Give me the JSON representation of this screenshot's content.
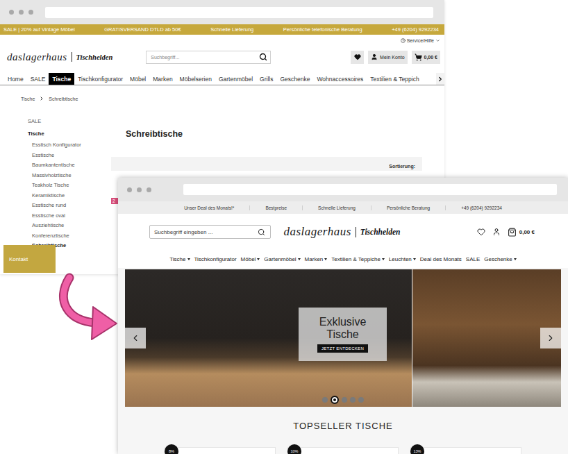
{
  "back_window": {
    "promo_bar": [
      "SALE | 20% auf Vintage Möbel",
      "GRATISVERSAND DTLD ab 50€",
      "Schnelle Lieferung",
      "Persönliche telefonische Beratung",
      "+49 (6204) 9292234"
    ],
    "service_link": "Service/Hilfe",
    "logo": {
      "name": "daslagerhaus",
      "brand": "Tischhelden"
    },
    "search": {
      "placeholder": "Suchbegriff..."
    },
    "account": "Mein Konto",
    "cart_total": "0,00 €",
    "nav": [
      {
        "label": "Home",
        "selected": false
      },
      {
        "label": "SALE",
        "selected": false
      },
      {
        "label": "Tische",
        "selected": true
      },
      {
        "label": "Tischkonfigurator",
        "selected": false
      },
      {
        "label": "Möbel",
        "selected": false
      },
      {
        "label": "Marken",
        "selected": false
      },
      {
        "label": "Möbelserien",
        "selected": false
      },
      {
        "label": "Gartenmöbel",
        "selected": false
      },
      {
        "label": "Grills",
        "selected": false
      },
      {
        "label": "Geschenke",
        "selected": false
      },
      {
        "label": "Wohnaccessoires",
        "selected": false
      },
      {
        "label": "Textilien & Teppich",
        "selected": false
      }
    ],
    "breadcrumb": [
      "Tische",
      "Schreibtische"
    ],
    "sidebar": [
      {
        "label": "SALE",
        "kind": "top",
        "selected": false
      },
      {
        "label": "Tische",
        "kind": "category",
        "selected": false
      },
      {
        "label": "Esstisch Konfigurator",
        "kind": "child",
        "selected": false
      },
      {
        "label": "Esstische",
        "kind": "child",
        "selected": false
      },
      {
        "label": "Baumkantentische",
        "kind": "child",
        "selected": false
      },
      {
        "label": "Massivholztische",
        "kind": "child",
        "selected": false
      },
      {
        "label": "Teakholz Tische",
        "kind": "child",
        "selected": false
      },
      {
        "label": "Keramiktische",
        "kind": "child",
        "selected": false
      },
      {
        "label": "Esstische rund",
        "kind": "child",
        "selected": false
      },
      {
        "label": "Esstische oval",
        "kind": "child",
        "selected": false
      },
      {
        "label": "Ausziehtische",
        "kind": "child",
        "selected": false
      },
      {
        "label": "Konferenztische",
        "kind": "child",
        "selected": false
      },
      {
        "label": "Schreibtische",
        "kind": "child",
        "selected": true
      }
    ],
    "page_title": "Schreibtische",
    "sort_label": "Sortierung:",
    "product_badge": "2",
    "contact_button": "Kontakt"
  },
  "front_window": {
    "info_bar": [
      "Unser Deal des Monats!*",
      "Bestpreise",
      "Schnelle Lieferung",
      "Persönliche Beratung",
      "+49 (6204) 9292234"
    ],
    "search": {
      "placeholder": "Suchbegriff eingeben ..."
    },
    "logo": {
      "name": "daslagerhaus",
      "brand": "Tischhelden"
    },
    "cart_total": "0,00 €",
    "nav": [
      {
        "label": "Tische",
        "dropdown": true
      },
      {
        "label": "Tischkonfigurator",
        "dropdown": false
      },
      {
        "label": "Möbel",
        "dropdown": true
      },
      {
        "label": "Gartenmöbel",
        "dropdown": true
      },
      {
        "label": "Marken",
        "dropdown": true
      },
      {
        "label": "Textilien & Teppiche",
        "dropdown": true
      },
      {
        "label": "Leuchten",
        "dropdown": true
      },
      {
        "label": "Deal des Monats",
        "dropdown": false
      },
      {
        "label": "SALE",
        "dropdown": false
      },
      {
        "label": "Geschenke",
        "dropdown": true
      }
    ],
    "hero": {
      "title": "Exklusive Tische",
      "button": "JETZT ENTDECKEN",
      "dots": [
        {
          "selected": false
        },
        {
          "selected": true
        },
        {
          "selected": false
        },
        {
          "selected": false
        },
        {
          "selected": false
        }
      ]
    },
    "section_title": "TOPSELLER TISCHE",
    "products": [
      {
        "badge": "8%"
      },
      {
        "badge": "10%"
      },
      {
        "badge": "13%"
      }
    ]
  }
}
